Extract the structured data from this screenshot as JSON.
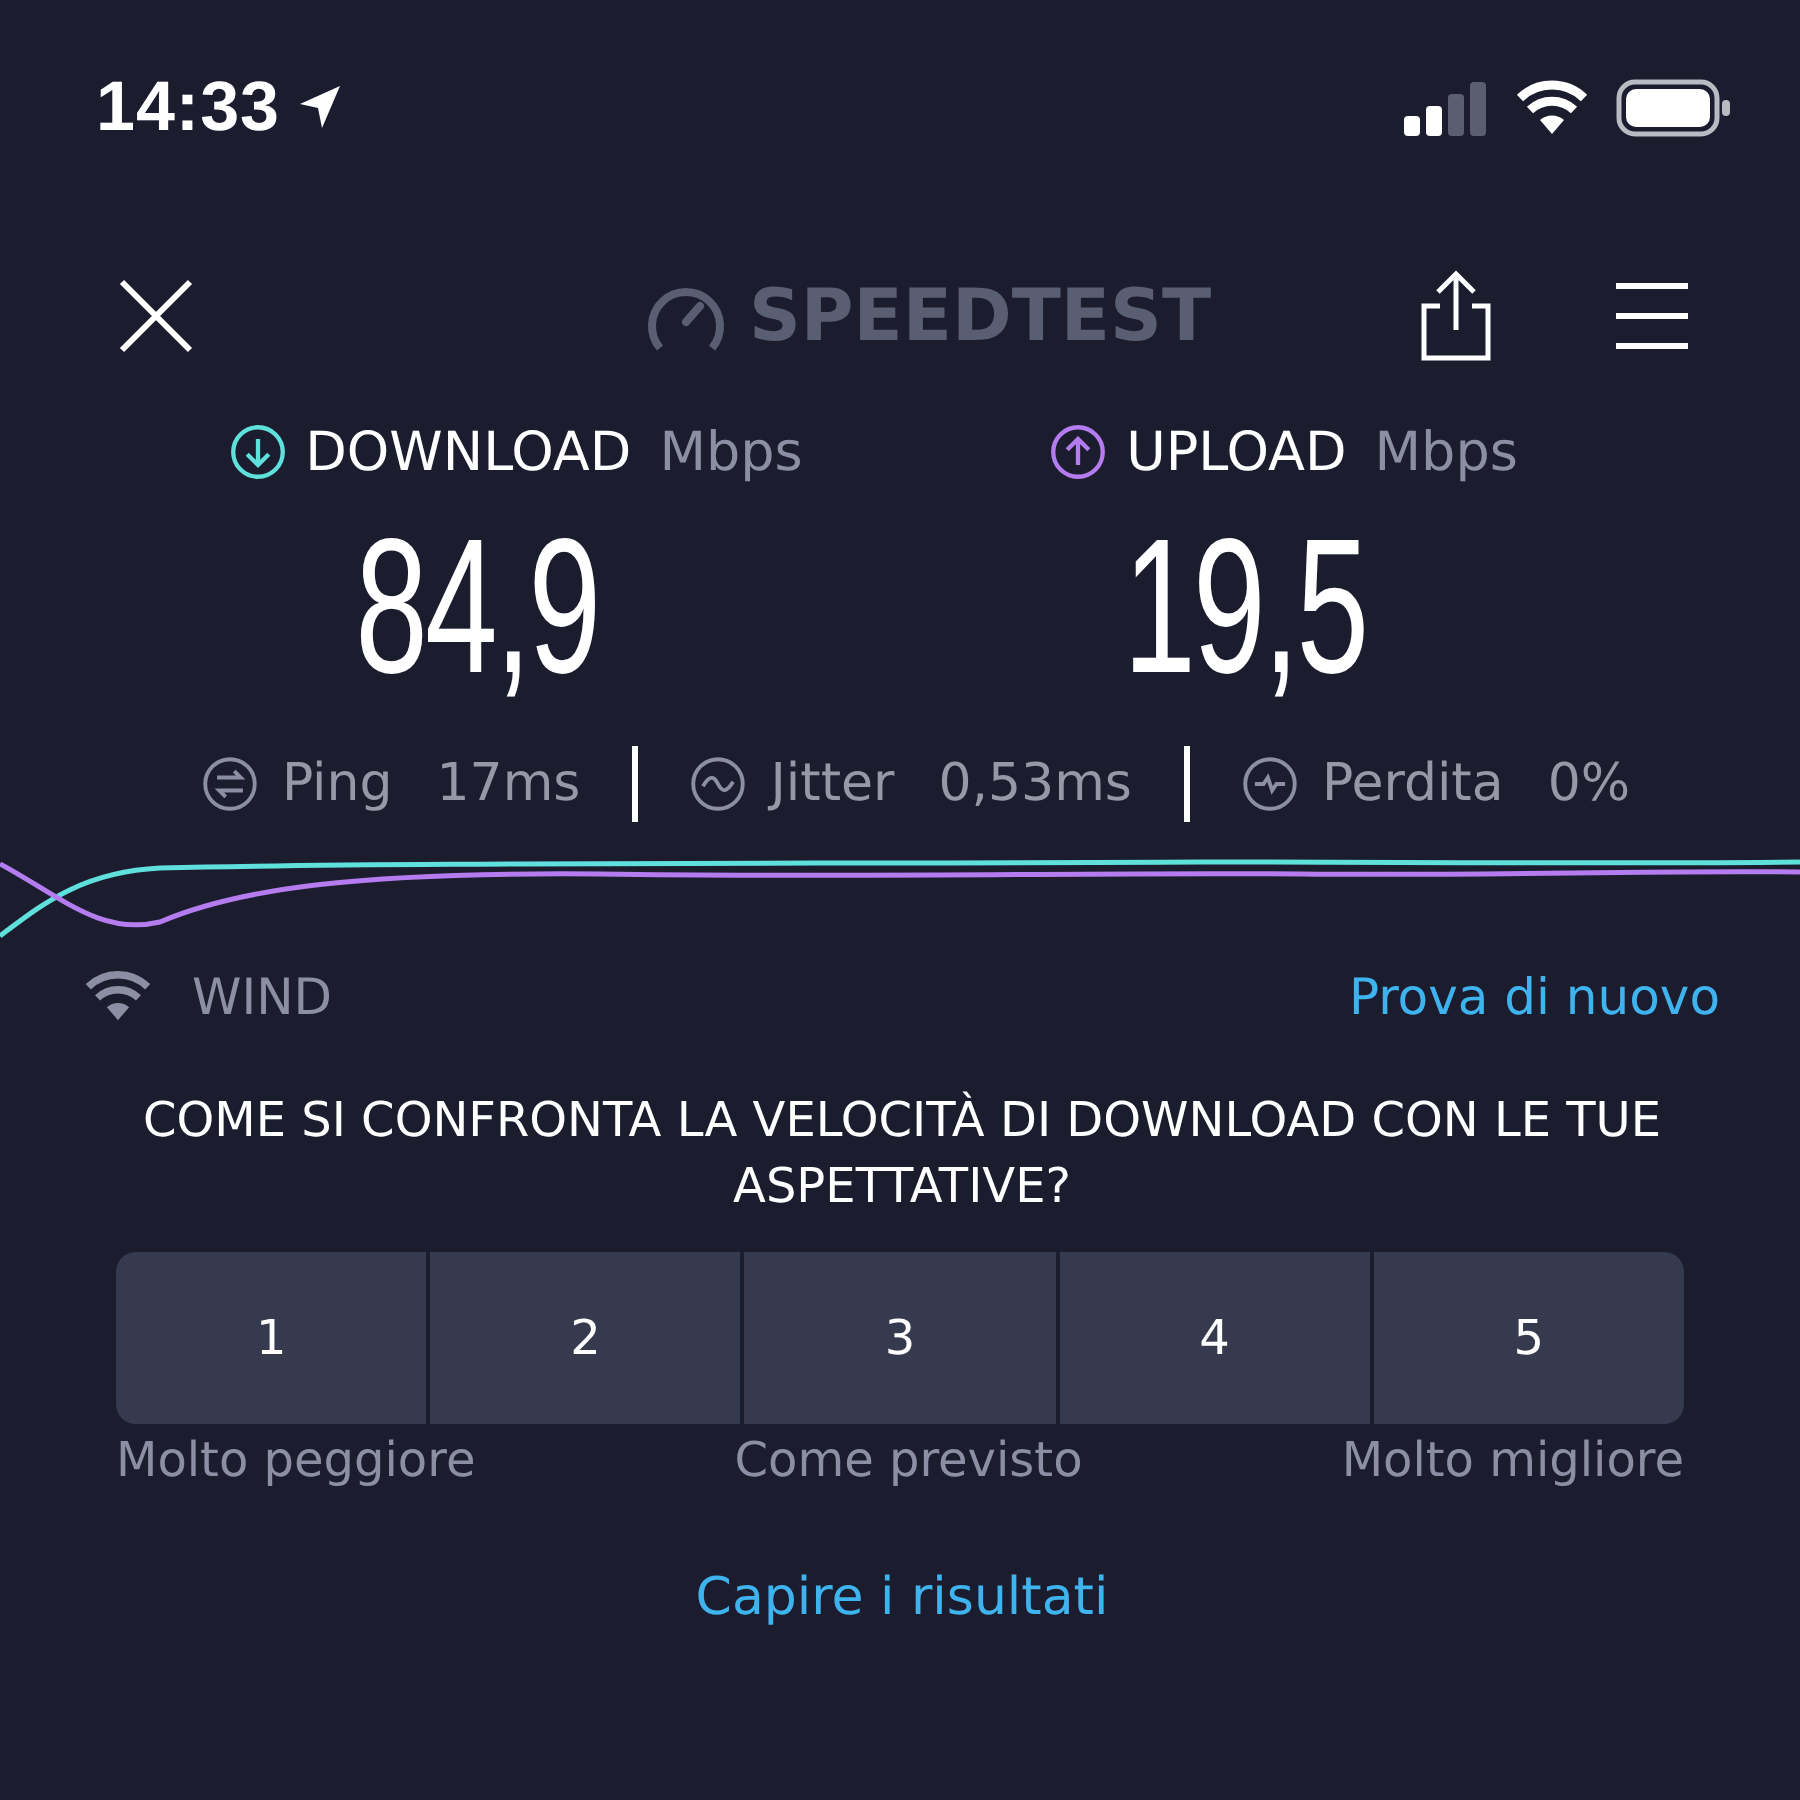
{
  "status_bar": {
    "time": "14:33"
  },
  "header": {
    "logo": "SPEEDTEST"
  },
  "results": [
    {
      "kind": "download",
      "label": "DOWNLOAD",
      "unit": "Mbps",
      "value": "84,9",
      "color": "#5fe0dc"
    },
    {
      "kind": "upload",
      "label": "UPLOAD",
      "unit": "Mbps",
      "value": "19,5",
      "color": "#b57cf0"
    }
  ],
  "metrics": [
    {
      "kind": "ping",
      "label": "Ping",
      "value": "17ms"
    },
    {
      "kind": "jitter",
      "label": "Jitter",
      "value": "0,53ms"
    },
    {
      "kind": "loss",
      "label": "Perdita",
      "value": "0%"
    }
  ],
  "network": {
    "name": "WIND",
    "retry_link": "Prova di nuovo"
  },
  "survey": {
    "question": "COME SI CONFRONTA LA VELOCITÀ DI DOWNLOAD CON LE TUE ASPETTATIVE?",
    "options": [
      {
        "label": "1",
        "selected": false
      },
      {
        "label": "2",
        "selected": false
      },
      {
        "label": "3",
        "selected": false
      },
      {
        "label": "4",
        "selected": false
      },
      {
        "label": "5",
        "selected": false
      }
    ],
    "scale_labels": [
      "Molto peggiore",
      "Come previsto",
      "Molto migliore"
    ]
  },
  "results_link": "Capire i risultati"
}
